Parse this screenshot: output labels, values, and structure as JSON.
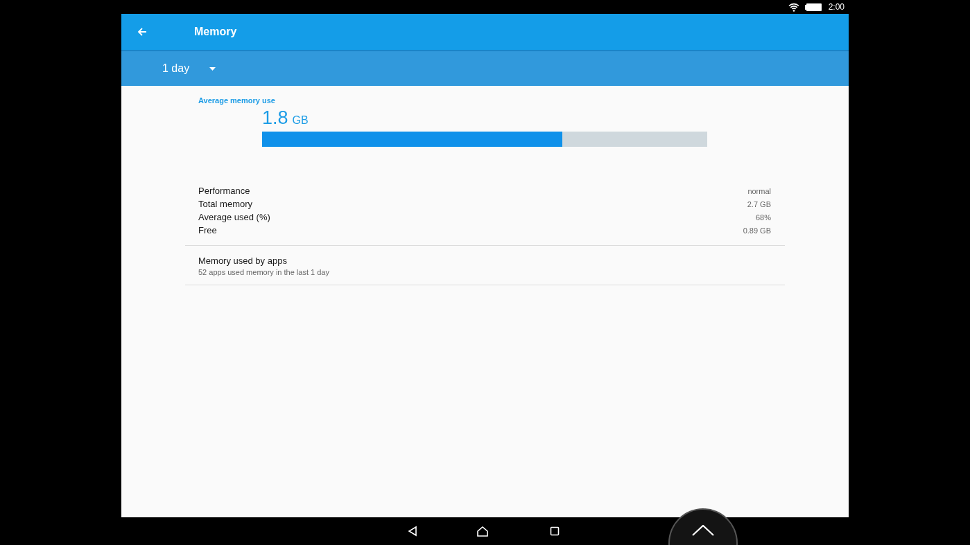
{
  "status_bar": {
    "time": "2:00"
  },
  "app_bar": {
    "title": "Memory"
  },
  "period_dropdown": {
    "value": "1 day"
  },
  "average": {
    "label": "Average memory use",
    "value": "1.8",
    "unit": "GB",
    "level": 0.675
  },
  "stats": [
    {
      "label": "Performance",
      "value": "normal"
    },
    {
      "label": "Total memory",
      "value": "2.7 GB"
    },
    {
      "label": "Average used (%)",
      "value": "68%"
    },
    {
      "label": "Free",
      "value": "0.89 GB"
    }
  ],
  "apps_item": {
    "title": "Memory used by apps",
    "subtitle": "52 apps used memory in the last 1 day"
  }
}
